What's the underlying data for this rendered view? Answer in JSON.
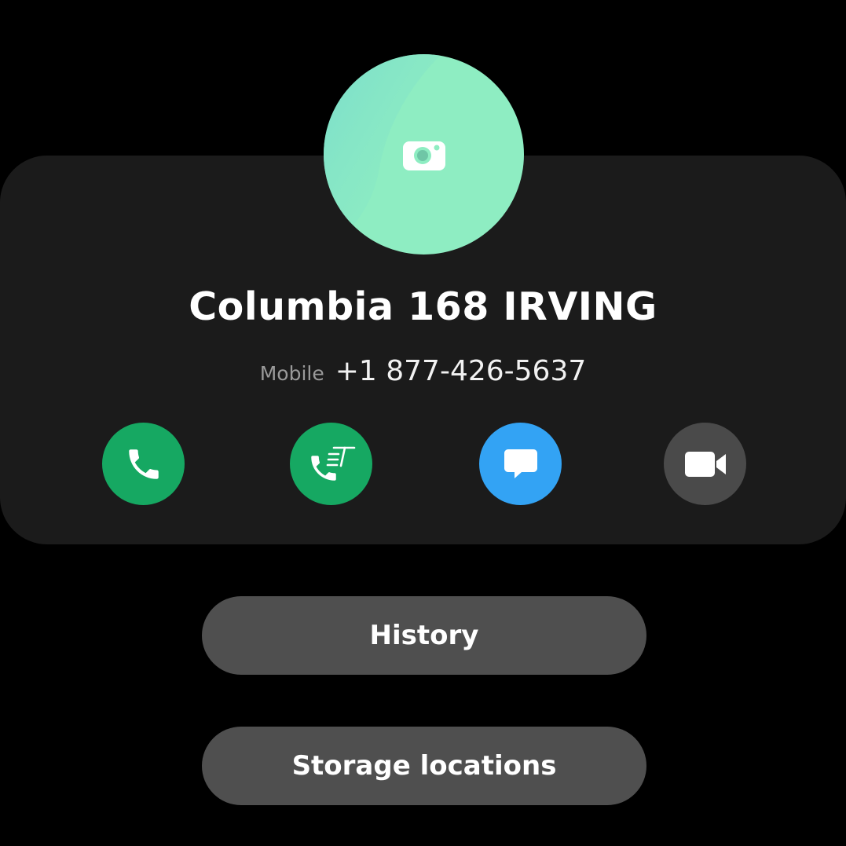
{
  "contact": {
    "name": "Columbia 168 IRVING",
    "phone_label": "Mobile",
    "phone_number": "+1 877-426-5637",
    "avatar_icon": "camera-icon",
    "avatar_color": "#8eedc2"
  },
  "actions": [
    {
      "name": "call",
      "icon": "phone-icon",
      "color": "#16a862"
    },
    {
      "name": "rtt-call",
      "icon": "phone-rtt-icon",
      "color": "#16a862"
    },
    {
      "name": "message",
      "icon": "chat-bubble-icon",
      "color": "#33a3f4"
    },
    {
      "name": "video-call",
      "icon": "video-camera-icon",
      "color": "#4a4a4a"
    }
  ],
  "buttons": {
    "history": "History",
    "storage": "Storage locations"
  }
}
